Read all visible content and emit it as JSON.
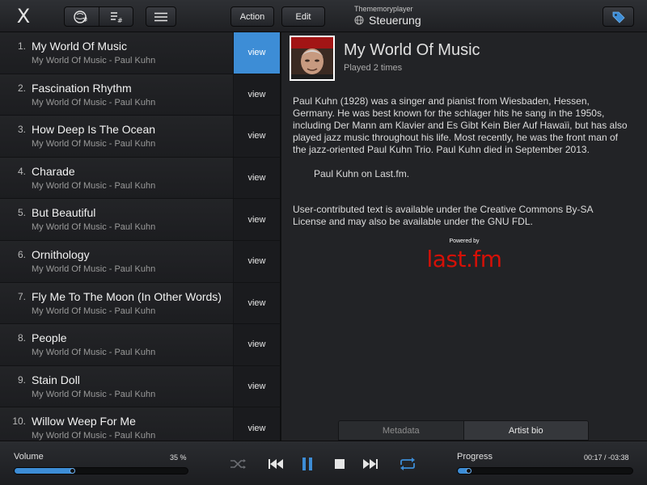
{
  "header": {
    "close_glyph": "X",
    "action_label": "Action",
    "edit_label": "Edit",
    "subtitle": "Thememoryplayer",
    "title": "Steuerung",
    "icons": [
      "close-icon",
      "artist-index-icon",
      "track-index-icon",
      "menu-icon",
      "globe-icon",
      "tag-icon"
    ]
  },
  "tracks": [
    {
      "num": "1.",
      "title": "My World Of Music",
      "sub": "My World Of Music - Paul Kuhn",
      "view": "view",
      "active": true
    },
    {
      "num": "2.",
      "title": "Fascination Rhythm",
      "sub": "My World Of Music - Paul Kuhn",
      "view": "view"
    },
    {
      "num": "3.",
      "title": "How Deep Is The Ocean",
      "sub": "My World Of Music - Paul Kuhn",
      "view": "view"
    },
    {
      "num": "4.",
      "title": "Charade",
      "sub": "My World Of Music - Paul Kuhn",
      "view": "view"
    },
    {
      "num": "5.",
      "title": "But Beautiful",
      "sub": "My World Of Music - Paul Kuhn",
      "view": "view"
    },
    {
      "num": "6.",
      "title": "Ornithology",
      "sub": "My World Of Music - Paul Kuhn",
      "view": "view"
    },
    {
      "num": "7.",
      "title": "Fly Me To The Moon (In Other Words)",
      "sub": "My World Of Music - Paul Kuhn",
      "view": "view"
    },
    {
      "num": "8.",
      "title": "People",
      "sub": "My World Of Music - Paul Kuhn",
      "view": "view"
    },
    {
      "num": "9.",
      "title": "Stain Doll",
      "sub": "My World Of Music - Paul Kuhn",
      "view": "view"
    },
    {
      "num": "10.",
      "title": "Willow Weep For Me",
      "sub": "My World Of Music - Paul Kuhn",
      "view": "view"
    }
  ],
  "detail": {
    "album_title": "My World Of Music",
    "played": "Played 2 times",
    "bio": "Paul Kuhn (1928) was a singer and pianist from Wiesbaden, Hessen, Germany. He was best known for the schlager hits he sang in the 1950s, including Der Mann am Klavier and Es Gibt Kein Bier Auf Hawaïi, but has also played jazz music throughout his life. Most recently, he was the front man of the jazz-oriented Paul Kuhn Trio. Paul Kuhn died in September 2013.",
    "lastfm_link": "Paul Kuhn on Last.fm.",
    "license": "User-contributed text is available under the Creative Commons By-SA License and may also be available under the GNU FDL.",
    "powered_by": "Powered by",
    "lastfm_logo": "last.fm",
    "tabs": [
      {
        "label": "Metadata",
        "active": false
      },
      {
        "label": "Artist bio",
        "active": true
      }
    ]
  },
  "player": {
    "volume_label": "Volume",
    "volume_value": "35 %",
    "volume_fraction": 0.35,
    "progress_label": "Progress",
    "progress_time": "00:17 / -03:38",
    "progress_fraction": 0.08,
    "accent": "#3d8dd6",
    "controls": [
      "shuffle-icon",
      "previous-icon",
      "pause-icon",
      "stop-icon",
      "next-icon",
      "repeat-icon"
    ]
  }
}
